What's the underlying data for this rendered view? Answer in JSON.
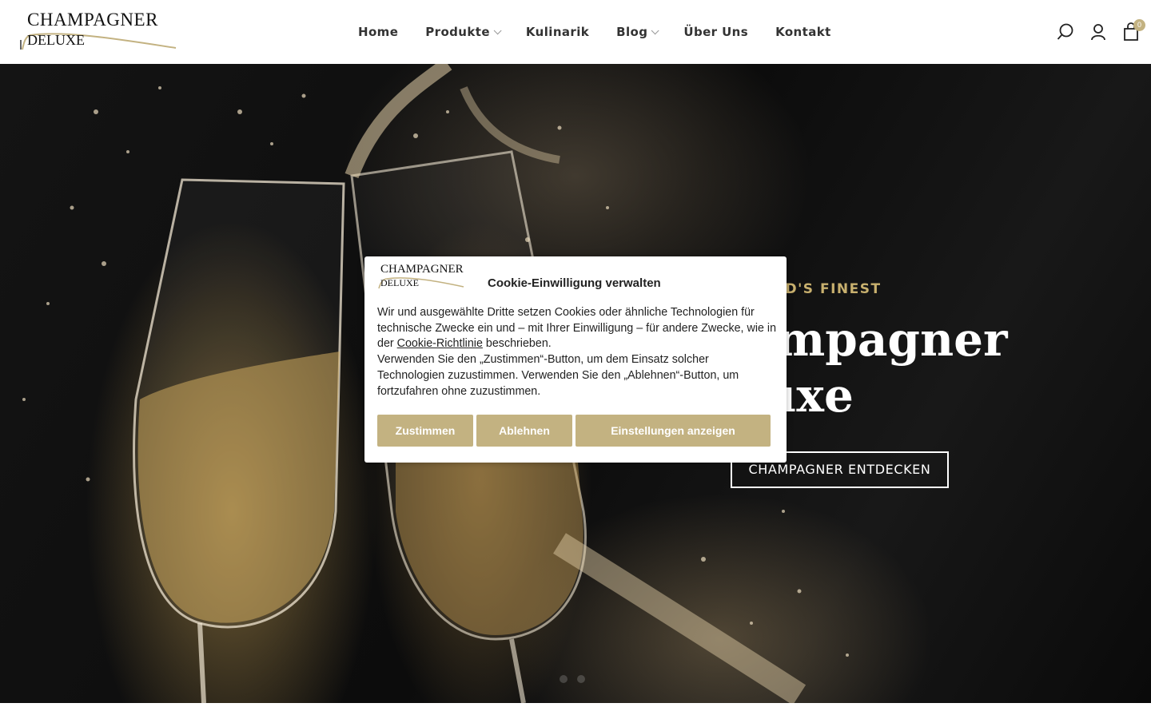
{
  "brand": {
    "line1": "CHAMPAGNER",
    "line2": "DELUXE",
    "accent": "#c3b281"
  },
  "nav": {
    "items": [
      {
        "label": "Home",
        "dropdown": false
      },
      {
        "label": "Produkte",
        "dropdown": true
      },
      {
        "label": "Kulinarik",
        "dropdown": false
      },
      {
        "label": "Blog",
        "dropdown": true
      },
      {
        "label": "Über Uns",
        "dropdown": false
      },
      {
        "label": "Kontakt",
        "dropdown": false
      }
    ]
  },
  "header_icons": {
    "search": "search-icon",
    "account": "user-icon",
    "cart": "shopping-bag-icon",
    "cart_count": "0"
  },
  "hero": {
    "eyebrow": "THE WORLD'S FINEST",
    "title_line1": "Champagner",
    "title_line2": "Deluxe",
    "cta": "CHAMPAGNER ENTDECKEN",
    "slides": 2
  },
  "cookie": {
    "title": "Cookie-Einwilligung verwalten",
    "text_part1": "Wir und ausgewählte Dritte setzen Cookies oder ähnliche Technologien für technische Zwecke ein und – mit Ihrer Einwilligung – für andere Zwecke, wie in der ",
    "policy_link": "Cookie-Richtlinie",
    "text_part2": " beschrieben.",
    "text_part3": "Verwenden Sie den „Zustimmen“-Button, um dem Einsatz solcher Technologien zuzustimmen. Verwenden Sie den „Ablehnen“-Button, um fortzufahren ohne zuzustimmen.",
    "accept": "Zustimmen",
    "reject": "Ablehnen",
    "settings": "Einstellungen anzeigen"
  }
}
